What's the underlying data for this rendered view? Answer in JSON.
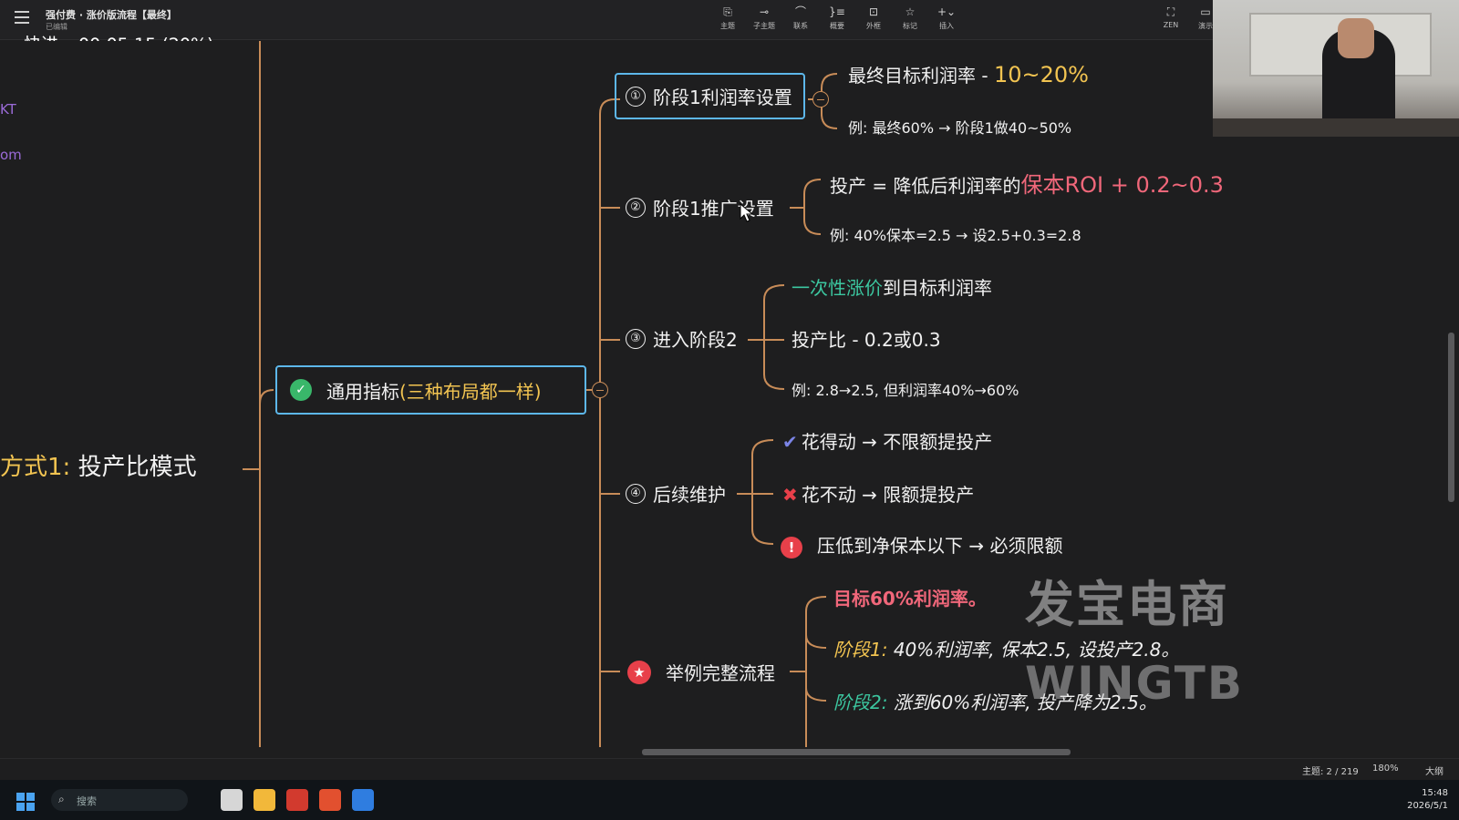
{
  "toolbar": {
    "doc_title": "强付费 · 涨价版流程【最终】",
    "doc_status": "已编辑",
    "tools": [
      {
        "label": "主题",
        "icon": "topic-icon"
      },
      {
        "label": "子主题",
        "icon": "subtopic-icon"
      },
      {
        "label": "联系",
        "icon": "relationship-icon"
      },
      {
        "label": "概要",
        "icon": "summary-icon"
      },
      {
        "label": "外框",
        "icon": "boundary-icon"
      },
      {
        "label": "标记",
        "icon": "marker-icon"
      },
      {
        "label": "插入",
        "icon": "insert-icon"
      }
    ],
    "zen_label": "ZEN",
    "present_label": "演示"
  },
  "player": {
    "speed_label": "快进",
    "timecode": "00:05:15 (20%)"
  },
  "side_fragments": [
    "KT",
    "om"
  ],
  "mindmap": {
    "root": {
      "prefix": "方式1:",
      "text": "投产比模式"
    },
    "main": {
      "text": "通用指标",
      "note": "(三种布局都一样)"
    },
    "branches": {
      "b1": {
        "num": "①",
        "label": "阶段1利润率设置",
        "leaf1": {
          "text": "最终目标利润率 - ",
          "highlight": "10~20%"
        },
        "leaf2": "例: 最终60% → 阶段1做40~50%"
      },
      "b2": {
        "num": "②",
        "label": "阶段1推广设置",
        "leaf1": {
          "text": "投产 = 降低后利润率的",
          "highlight": "保本ROI + 0.2~0.3"
        },
        "leaf2": "例: 40%保本=2.5 → 设2.5+0.3=2.8"
      },
      "b3": {
        "num": "③",
        "label": "进入阶段2",
        "leaf1": {
          "highlight": "一次性涨价",
          "text": "到目标利润率"
        },
        "leaf2": "投产比 - 0.2或0.3",
        "leaf3": "例: 2.8→2.5, 但利润率40%→60%"
      },
      "b4": {
        "num": "④",
        "label": "后续维护",
        "leaf1": "花得动 → 不限额提投产",
        "leaf2": "花不动 → 限额提投产",
        "leaf3": "压低到净保本以下 → 必须限额"
      },
      "b5": {
        "label": "举例完整流程",
        "leaf1": "目标60%利润率。",
        "leaf2": {
          "tag": "阶段1:",
          "text": " 40%利润率, 保本2.5, 设投产2.8。"
        },
        "leaf3": {
          "tag": "阶段2:",
          "text": " 涨到60%利润率, 投产降为2.5。"
        }
      }
    }
  },
  "watermark": {
    "cn": "发宝电商",
    "en": "WINGTB"
  },
  "statusbar": {
    "topics": "主题: 2 / 219",
    "zoom": "180%",
    "outline": "大纲"
  },
  "taskbar": {
    "search_placeholder": "搜索",
    "time": "15:48",
    "date": "2026/5/1"
  },
  "colors": {
    "accent_blue": "#5db7ea",
    "branch_line": "#c88c58",
    "gold": "#f2c451",
    "pink": "#f0677a",
    "teal": "#3cc7a0"
  }
}
